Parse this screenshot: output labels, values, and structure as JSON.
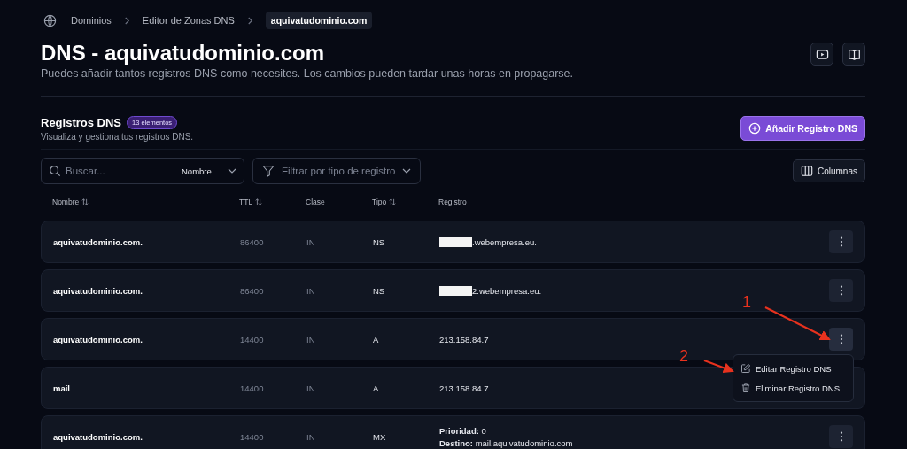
{
  "breadcrumb": [
    {
      "label": "Dominios",
      "selected": false
    },
    {
      "label": "Editor de Zonas DNS",
      "selected": false
    },
    {
      "label": "aquivatudominio.com",
      "selected": true
    }
  ],
  "title": "DNS - aquivatudominio.com",
  "subtitle": "Puedes añadir tantos registros DNS como necesites. Los cambios pueden tardar unas horas en propagarse.",
  "section": {
    "title": "Registros DNS",
    "badge": "13 elementos",
    "description": "Visualiza y gestiona tus registros DNS.",
    "add_button": "Añadir Registro DNS"
  },
  "search": {
    "placeholder": "Buscar...",
    "field_select": "Nombre"
  },
  "filter": {
    "placeholder": "Filtrar por tipo de registro"
  },
  "columns_button": "Columnas",
  "table": {
    "columns": [
      {
        "label": "Nombre",
        "sortable": true
      },
      {
        "label": "TTL",
        "sortable": true
      },
      {
        "label": "Clase",
        "sortable": false
      },
      {
        "label": "Tipo",
        "sortable": true
      },
      {
        "label": "Registro",
        "sortable": false
      }
    ],
    "rows": [
      {
        "name": "aquivatudominio.com.",
        "ttl": "86400",
        "class": "IN",
        "type": "NS",
        "record": [
          ".webempresa.eu."
        ],
        "redacted": true,
        "menu_open": false
      },
      {
        "name": "aquivatudominio.com.",
        "ttl": "86400",
        "class": "IN",
        "type": "NS",
        "record": [
          "2.webempresa.eu."
        ],
        "redacted": true,
        "menu_open": false
      },
      {
        "name": "aquivatudominio.com.",
        "ttl": "14400",
        "class": "IN",
        "type": "A",
        "record": [
          "213.158.84.7"
        ],
        "redacted": false,
        "menu_open": true
      },
      {
        "name": "mail",
        "ttl": "14400",
        "class": "IN",
        "type": "A",
        "record": [
          "213.158.84.7"
        ],
        "redacted": false,
        "menu_open": false
      },
      {
        "name": "aquivatudominio.com.",
        "ttl": "14400",
        "class": "IN",
        "type": "MX",
        "record": [
          "**Prioridad:** 0",
          "**Destino:** mail.aquivatudominio.com"
        ],
        "redacted": false,
        "menu_open": false
      }
    ]
  },
  "row_menu": [
    {
      "kind": "edit",
      "label": "Editar Registro DNS"
    },
    {
      "kind": "delete",
      "label": "Eliminar Registro DNS"
    }
  ],
  "annotations": [
    {
      "label": "1",
      "kind": "long"
    },
    {
      "label": "2",
      "kind": "short"
    }
  ]
}
